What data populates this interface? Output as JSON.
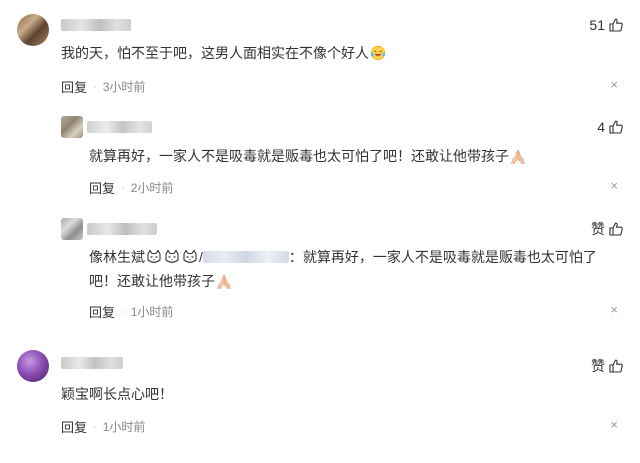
{
  "comments": [
    {
      "likes": "51",
      "text": "我的天，怕不至于吧，这男人面相实在不像个好人",
      "reply_label": "回复",
      "time": "3小时前",
      "close": "×"
    },
    {
      "likes": "4",
      "text": "就算再好，一家人不是吸毒就是贩毒也太可怕了吧！还敢让他带孩子",
      "reply_label": "回复",
      "time": "2小时前",
      "close": "×"
    },
    {
      "likes": "赞",
      "text_prefix": "像林生斌",
      "text_slash": "/",
      "text_line1": "：就算再好，一家人不是吸毒就是贩毒也太可怕了",
      "text_line2": "吧！还敢让他带孩子",
      "reply_label": "回复",
      "time": "1小时前",
      "close": "×"
    },
    {
      "likes": "赞",
      "text": "颖宝啊长点心吧！",
      "reply_label": "回复",
      "time": "1小时前",
      "close": "×"
    }
  ],
  "separator": "·",
  "colors": {
    "text": "#333333",
    "meta": "#888888",
    "close": "#999999"
  },
  "icons": [
    "thumb-up-icon",
    "laughing-emoji-icon",
    "praying-hands-icon",
    "cat-emoji-icon",
    "close-icon"
  ]
}
